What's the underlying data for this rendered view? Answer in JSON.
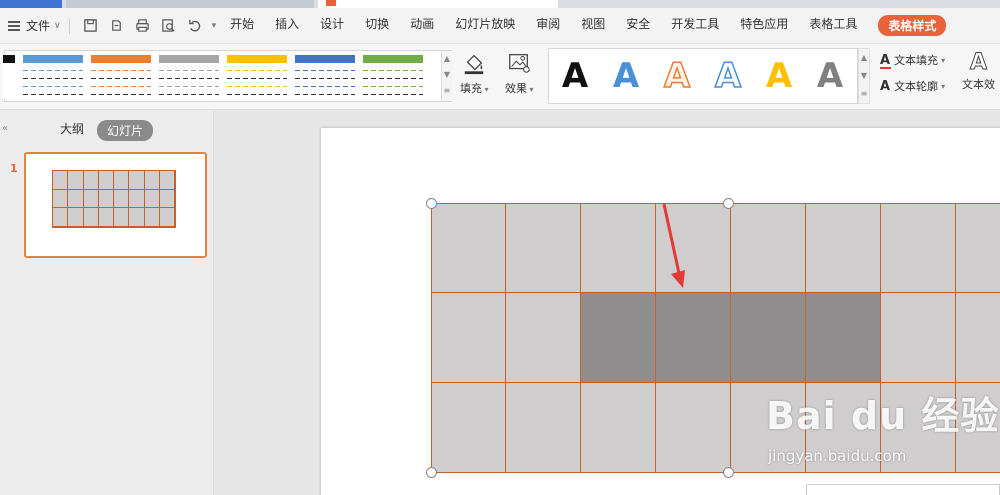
{
  "menubar": {
    "file_label": "文件",
    "tabs": [
      {
        "label": "开始"
      },
      {
        "label": "插入"
      },
      {
        "label": "设计"
      },
      {
        "label": "切换"
      },
      {
        "label": "动画"
      },
      {
        "label": "幻灯片放映"
      },
      {
        "label": "审阅"
      },
      {
        "label": "视图"
      },
      {
        "label": "安全"
      },
      {
        "label": "开发工具"
      },
      {
        "label": "特色应用"
      },
      {
        "label": "表格工具"
      },
      {
        "label": "表格样式"
      }
    ],
    "active_tab": "表格样式"
  },
  "ribbon": {
    "fill_label": "填充",
    "effect_label": "效果",
    "text_fill_label": "文本填充",
    "text_outline_label": "文本轮廓",
    "text_effect_label": "文本效",
    "wordart_glyph": "A",
    "table_style_colors": [
      "#5b9bd5",
      "#ed7d31",
      "#a5a5a5",
      "#ffc000",
      "#4472c4",
      "#70ad47"
    ],
    "wordart_colors": [
      "#111111",
      "#4a90d9",
      "#ed7d31",
      "#4a90d9",
      "#ffc000",
      "#808080"
    ]
  },
  "leftpane": {
    "outline_tab": "大纲",
    "slides_tab": "幻灯片",
    "slide_number": "1"
  },
  "table": {
    "cols": 8,
    "rows": 3,
    "light_fill": "#cfcdcd",
    "dark_fill": "#8f8d8e",
    "border_color": "#c2622a",
    "dark_cells": [
      [
        1,
        2
      ],
      [
        1,
        3
      ],
      [
        1,
        4
      ],
      [
        1,
        5
      ]
    ]
  },
  "watermark": {
    "brand": "Bai du 经验",
    "url": "jingyan.baidu.com"
  },
  "colors": {
    "accent": "#e8623a",
    "arrow": "#e53935"
  }
}
